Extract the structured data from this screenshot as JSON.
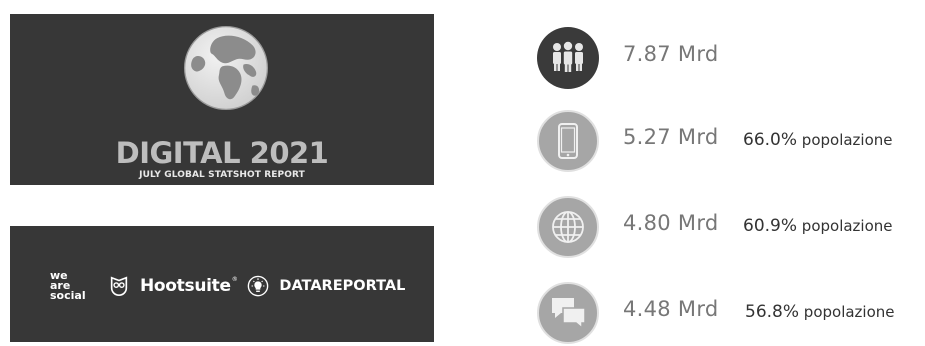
{
  "report": {
    "title": "DIGITAL 2021",
    "subtitle": "JULY GLOBAL STATSHOT REPORT"
  },
  "partners": {
    "we_are_social": [
      "we",
      "are",
      "social"
    ],
    "hootsuite": "Hootsuite",
    "hootsuite_mark": "®",
    "datareportal": "DATAREPORTAL"
  },
  "stats": [
    {
      "icon": "people-icon",
      "value": "7.87 Mrd",
      "percent": "",
      "percent_label": ""
    },
    {
      "icon": "mobile-phone-icon",
      "value": "5.27 Mrd",
      "percent": "66.0%",
      "percent_label": "popolazione"
    },
    {
      "icon": "globe-icon",
      "value": "4.80 Mrd",
      "percent": "60.9%",
      "percent_label": "popolazione"
    },
    {
      "icon": "chat-bubbles-icon",
      "value": "4.48 Mrd",
      "percent": "56.8%",
      "percent_label": "popolazione"
    }
  ],
  "colors": {
    "banner_bg": "#373737",
    "icon_dark": "#3a3a3a",
    "icon_light": "#a6a6a6",
    "value_text": "#777777"
  }
}
